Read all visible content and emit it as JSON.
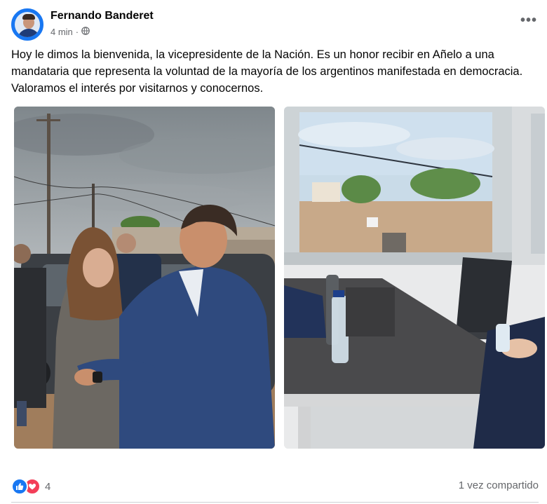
{
  "post": {
    "author": "Fernando Banderet",
    "time": "4 min",
    "separator": "·",
    "privacy_icon": "globe-icon",
    "menu_icon": "more-options-icon",
    "more_glyph": "•••",
    "text": "Hoy le dimos la bienvenida, la vicepresidente de la Nación. Es un honor recibir en Añelo a una mandataria que representa la voluntad de la mayoría de los argentinos manifestada en democracia. Valoramos el interés por visitarnos y conocernos."
  },
  "photos": [
    {
      "subject": "greeting-outdoors-photo"
    },
    {
      "subject": "office-desk-photo"
    }
  ],
  "footer": {
    "reactions": [
      "like-icon",
      "love-icon"
    ],
    "reaction_count": "4",
    "shares": "1 vez compartido"
  },
  "colors": {
    "accent": "#1877f2",
    "love": "#f33e58",
    "secondary_text": "#65676b"
  }
}
